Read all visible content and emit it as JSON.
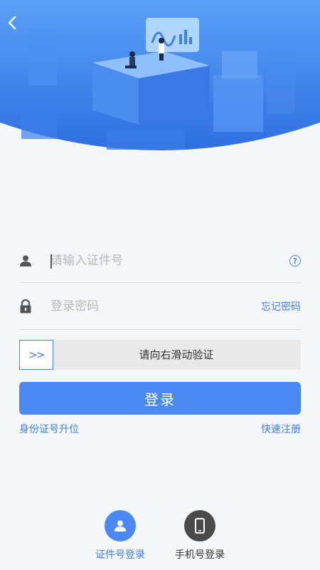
{
  "header": {
    "back_icon": "chevron-left-icon",
    "background_color": "#3f86ee",
    "illustration": "isometric-data-city"
  },
  "form": {
    "id_placeholder": "请输入证件号",
    "id_value": "",
    "id_icon": "user-icon",
    "help_icon": "question-circle-icon",
    "help_symbol": "?",
    "password_placeholder": "登录密码",
    "password_value": "",
    "password_icon": "lock-icon",
    "forgot_label": "忘记密码"
  },
  "slider": {
    "handle_symbol": ">>",
    "label": "请向右滑动验证"
  },
  "login_button": {
    "label": "登录",
    "color": "#4a88f2"
  },
  "links": {
    "upgrade_label": "身份证号升位",
    "register_label": "快速注册",
    "color": "#3f7fe6"
  },
  "login_options": [
    {
      "label": "证件号登录",
      "icon": "user-icon",
      "color": "#4a88f2",
      "label_color": "#3f7fe6"
    },
    {
      "label": "手机号登录",
      "icon": "phone-icon",
      "color": "#4a4a4a",
      "label_color": "#333333"
    }
  ]
}
